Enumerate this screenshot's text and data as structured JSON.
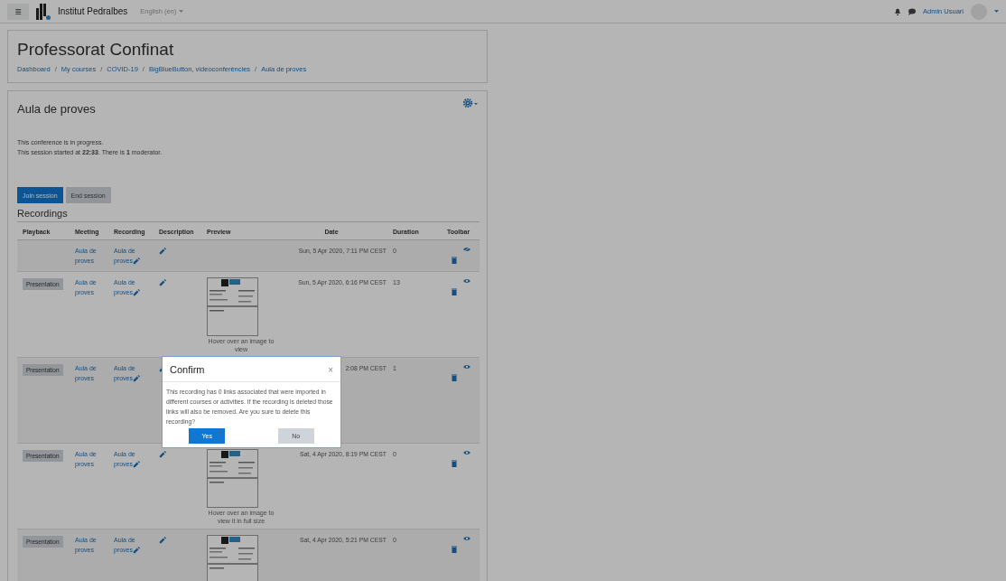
{
  "navbar": {
    "menu_glyph": "≡",
    "site_name": "Institut Pedralbes",
    "language": "English (en)",
    "user_name": "Admin Usuari"
  },
  "header": {
    "title": "Professorat Confinat",
    "breadcrumb": [
      {
        "label": "Dashboard"
      },
      {
        "separator": "/",
        "label": "My courses"
      },
      {
        "separator": "/",
        "label": "COVID-19"
      },
      {
        "separator": "/",
        "label": "BigBlueButton, videoconferències"
      },
      {
        "separator": "/",
        "label": "Aula de proves"
      }
    ]
  },
  "activity": {
    "title": "Aula de proves",
    "status_line": "This conference is in progress.",
    "session_line": "This session started at **22:33**. There is **1** moderator.",
    "buttons": [
      {
        "label": "Join session",
        "kind": "primary"
      },
      {
        "label": "End session",
        "kind": "secondary"
      }
    ],
    "recordings_title": "Recordings",
    "table": {
      "columns": [
        "Playback",
        "Meeting",
        "Recording",
        "Description",
        "Preview",
        "Date",
        "Duration",
        "Toolbar"
      ],
      "rows": [
        {
          "playback": null,
          "meeting": "Aula de proves",
          "recording": "Aula de proves",
          "preview": null,
          "preview_hint": null,
          "date": "Sun, 5 Apr 2020, 7:11 PM CEST",
          "duration": "0",
          "published": false
        },
        {
          "playback": "Presentation",
          "meeting": "Aula de proves",
          "recording": "Aula de proves",
          "preview_hint": "Hover over an image to view",
          "date": "Sun, 5 Apr 2020, 6:16 PM CEST",
          "duration": "13",
          "published": true
        },
        {
          "playback": "Presentation",
          "meeting": "Aula de proves",
          "recording": "Aula de proves",
          "preview": null,
          "preview_hint": null,
          "date": "2:08 PM CEST",
          "duration": "1",
          "published": true
        },
        {
          "playback": "Presentation",
          "meeting": "Aula de proves",
          "recording": "Aula de proves",
          "preview_hint": "Hover over an image to view it in full size",
          "date": "Sat, 4 Apr 2020, 8:19 PM CEST",
          "duration": "0",
          "published": true
        },
        {
          "playback": "Presentation",
          "meeting": "Aula de proves",
          "recording": "Aula de proves",
          "preview_hint": null,
          "date": "Sat, 4 Apr 2020, 5:21 PM CEST",
          "duration": "0",
          "published": true
        }
      ]
    }
  },
  "dialog": {
    "title": "Confirm",
    "close_glyph": "×",
    "message": "This recording has 0 links associated that were imported in different courses or activities. If the recording is deleted those links will also be removed. Are you sure to delete this recording?",
    "buttons": [
      {
        "label": "Yes",
        "kind": "primary"
      },
      {
        "label": "No",
        "kind": "secondary"
      }
    ]
  }
}
